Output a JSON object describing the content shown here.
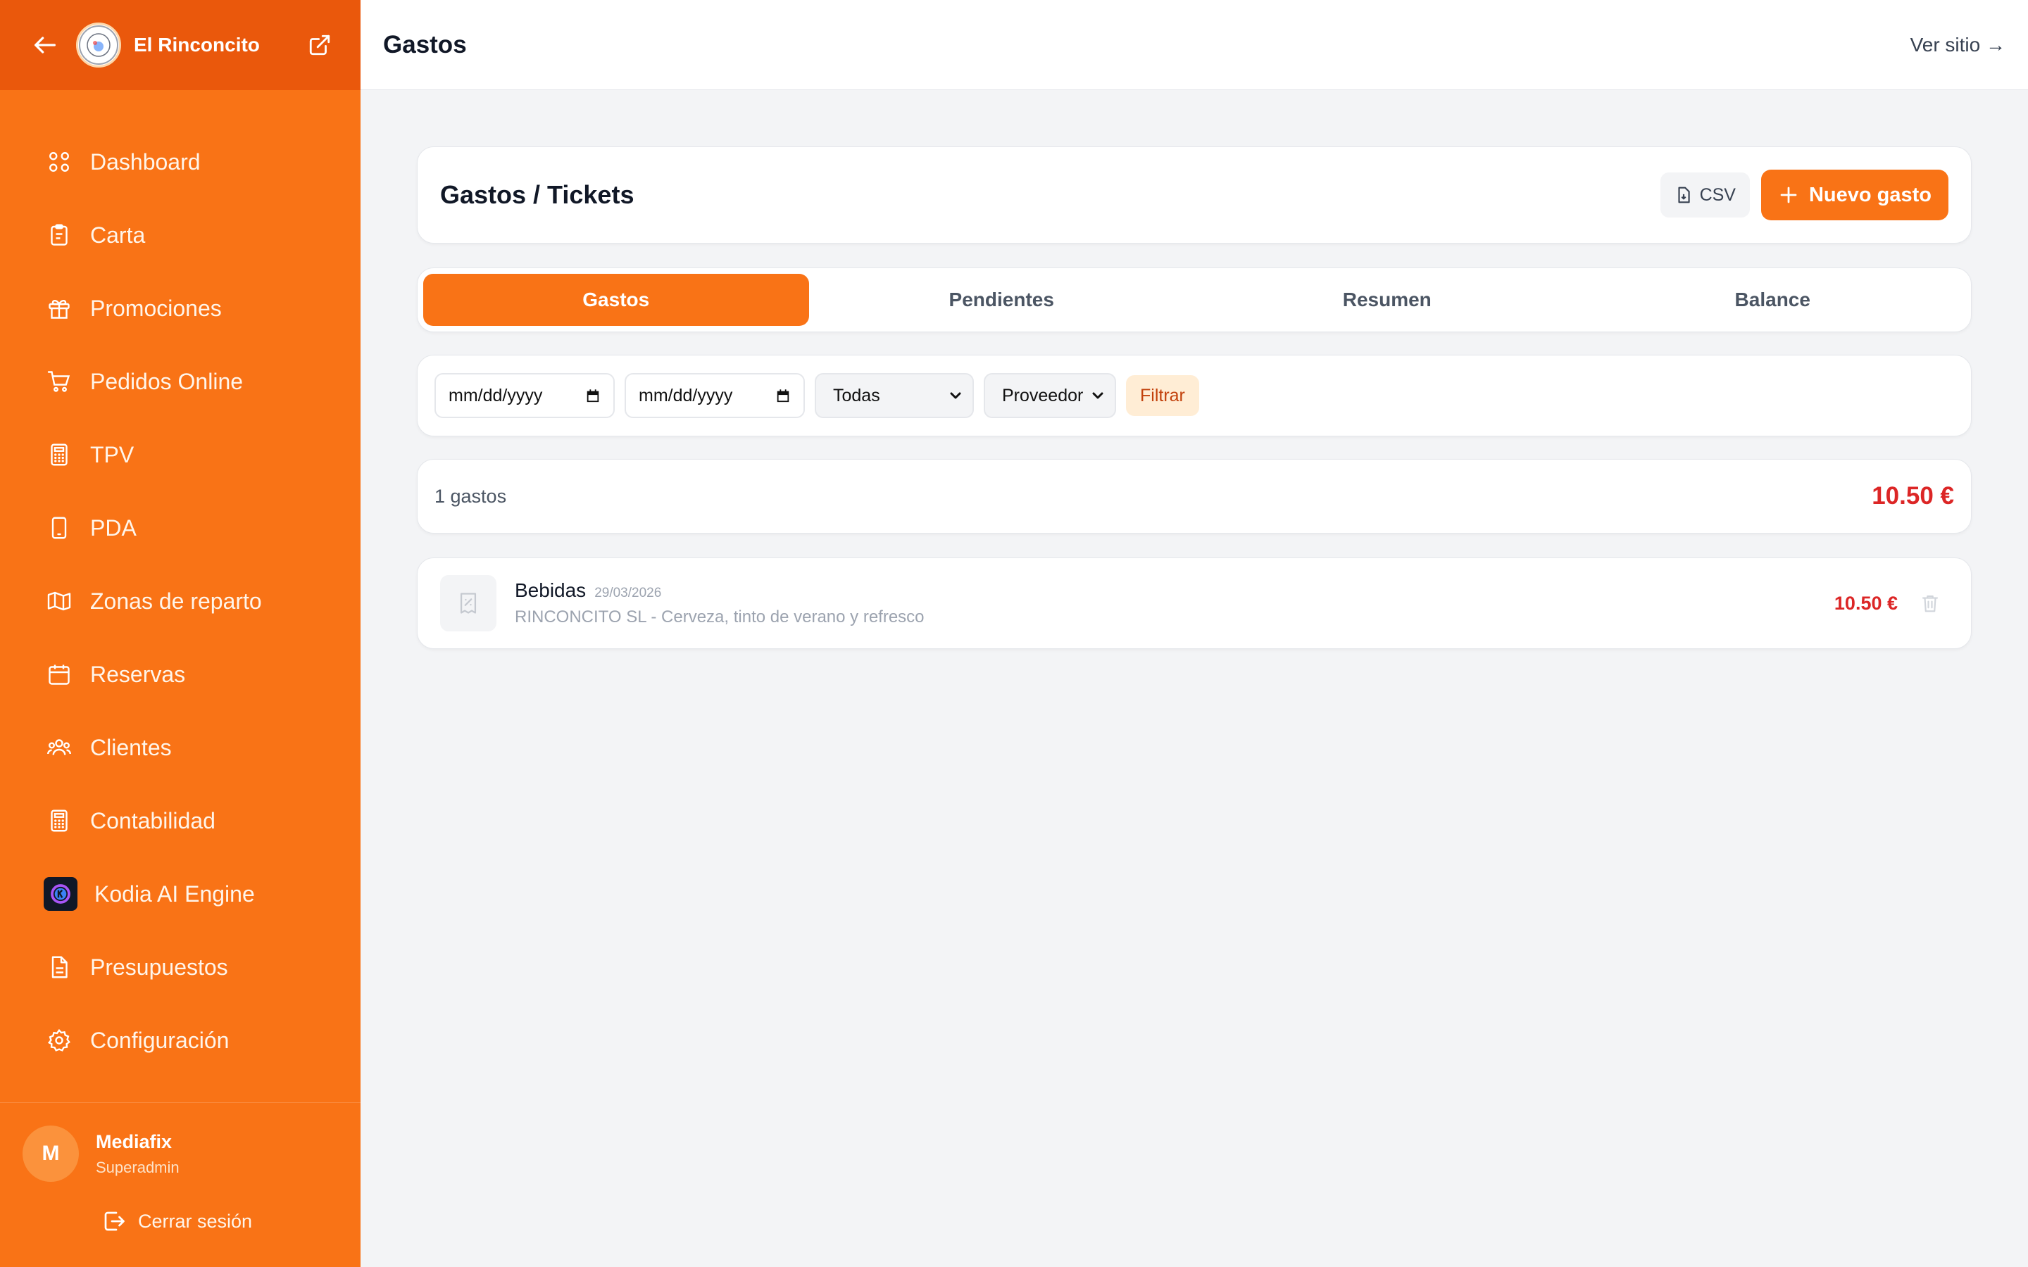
{
  "sidebar": {
    "brand": "El Rinconcito",
    "items": [
      {
        "label": "Dashboard",
        "icon": "grid-icon"
      },
      {
        "label": "Carta",
        "icon": "clipboard-icon"
      },
      {
        "label": "Promociones",
        "icon": "gift-icon"
      },
      {
        "label": "Pedidos Online",
        "icon": "cart-icon"
      },
      {
        "label": "TPV",
        "icon": "calculator-icon"
      },
      {
        "label": "PDA",
        "icon": "phone-icon"
      },
      {
        "label": "Zonas de reparto",
        "icon": "map-icon"
      },
      {
        "label": "Reservas",
        "icon": "calendar-icon"
      },
      {
        "label": "Clientes",
        "icon": "users-icon"
      },
      {
        "label": "Contabilidad",
        "icon": "calculator-icon"
      },
      {
        "label": "Kodia AI Engine",
        "icon": "kodia-logo-icon"
      },
      {
        "label": "Presupuestos",
        "icon": "document-icon"
      },
      {
        "label": "Configuración",
        "icon": "gear-icon"
      }
    ],
    "user": {
      "initial": "M",
      "name": "Mediafix",
      "role": "Superadmin"
    },
    "logout_label": "Cerrar sesión",
    "accent": "#f97316",
    "header_bg": "#ea580c"
  },
  "topbar": {
    "title": "Gastos",
    "view_site": "Ver sitio →"
  },
  "header_card": {
    "title": "Gastos / Tickets",
    "csv_label": "CSV",
    "new_label": "Nuevo gasto"
  },
  "tabs": [
    {
      "label": "Gastos",
      "active": true
    },
    {
      "label": "Pendientes",
      "active": false
    },
    {
      "label": "Resumen",
      "active": false
    },
    {
      "label": "Balance",
      "active": false
    }
  ],
  "filters": {
    "date_from": "mm/dd/yyyy",
    "date_to": "mm/dd/yyyy",
    "category": "Todas",
    "supplier": "Proveedor",
    "filter_label": "Filtrar"
  },
  "summary": {
    "count": "1 gastos",
    "total": "10.50 €"
  },
  "expenses": [
    {
      "category": "Bebidas",
      "date": "29/03/2026",
      "description": "RINCONCITO SL - Cerveza, tinto de verano y refresco",
      "amount": "10.50 €"
    }
  ],
  "colors": {
    "accent": "#f97316",
    "danger": "#dc2626",
    "background": "#f3f4f6"
  }
}
